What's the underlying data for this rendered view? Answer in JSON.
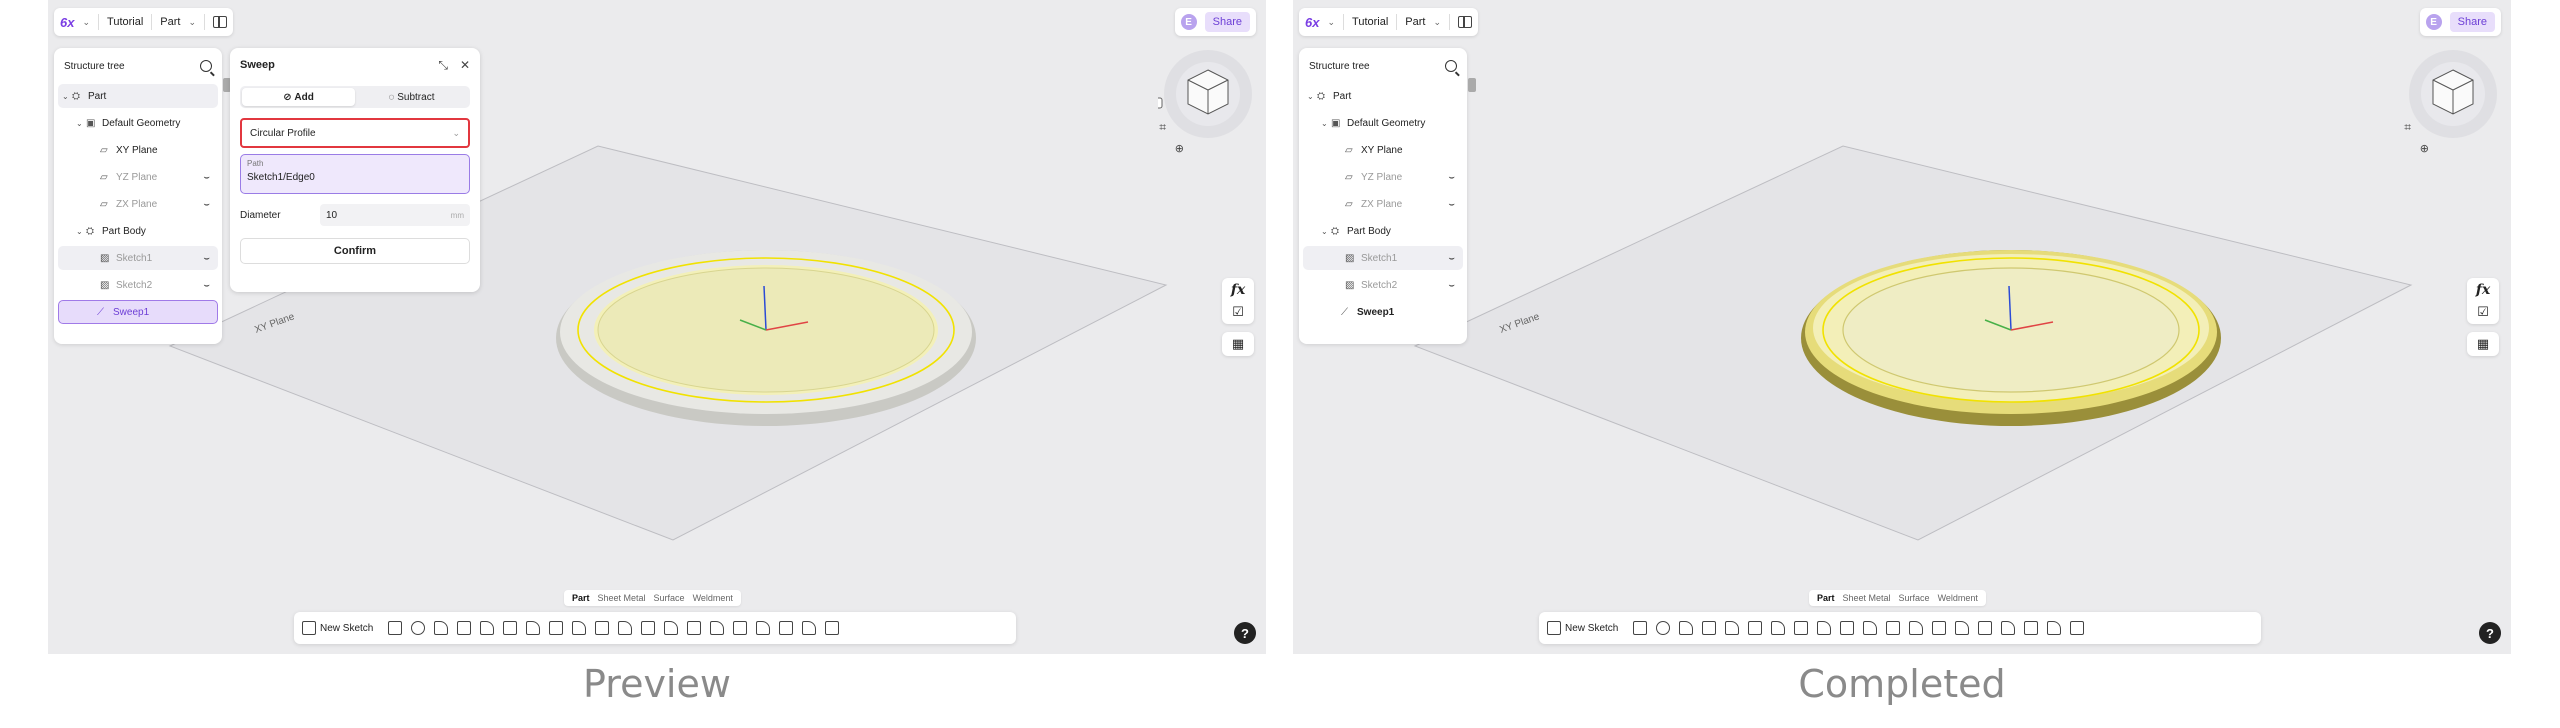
{
  "panes": {
    "left": {
      "caption": "Preview",
      "topbar": {
        "logo": "6x",
        "crumb1": "Tutorial",
        "crumb2": "Part",
        "share": "Share",
        "avatar": "E"
      },
      "tree": {
        "title": "Structure tree",
        "items": [
          {
            "label": "Part"
          },
          {
            "label": "Default Geometry"
          },
          {
            "label": "XY Plane"
          },
          {
            "label": "YZ Plane"
          },
          {
            "label": "ZX Plane"
          },
          {
            "label": "Part Body"
          },
          {
            "label": "Sketch1"
          },
          {
            "label": "Sketch2"
          },
          {
            "label": "Sweep1"
          }
        ]
      },
      "sweep": {
        "title": "Sweep",
        "add": "Add",
        "subtract": "Subtract",
        "profile": "Circular Profile",
        "path_label": "Path",
        "path_value": "Sketch1/Edge0",
        "diameter_label": "Diameter",
        "diameter_value": "10",
        "diameter_unit": "mm",
        "confirm": "Confirm"
      },
      "plane_label": "XY Plane",
      "fx": "fx",
      "tabs": [
        "Part",
        "Sheet Metal",
        "Surface",
        "Weldment"
      ],
      "new_sketch": "New Sketch",
      "help": "?"
    },
    "right": {
      "caption": "Completed",
      "topbar": {
        "logo": "6x",
        "crumb1": "Tutorial",
        "crumb2": "Part",
        "share": "Share",
        "avatar": "E"
      },
      "tree": {
        "title": "Structure tree",
        "items": [
          {
            "label": "Part"
          },
          {
            "label": "Default Geometry"
          },
          {
            "label": "XY Plane"
          },
          {
            "label": "YZ Plane"
          },
          {
            "label": "ZX Plane"
          },
          {
            "label": "Part Body"
          },
          {
            "label": "Sketch1"
          },
          {
            "label": "Sketch2"
          },
          {
            "label": "Sweep1"
          }
        ]
      },
      "plane_label": "XY Plane",
      "fx": "fx",
      "tabs": [
        "Part",
        "Sheet Metal",
        "Surface",
        "Weldment"
      ],
      "new_sketch": "New Sketch",
      "help": "?"
    }
  },
  "colors": {
    "accent": "#7b3fe4",
    "selection_bg": "#e7dcfb",
    "highlight_red": "#e2373f",
    "sketch_yellow": "#f1e200"
  }
}
